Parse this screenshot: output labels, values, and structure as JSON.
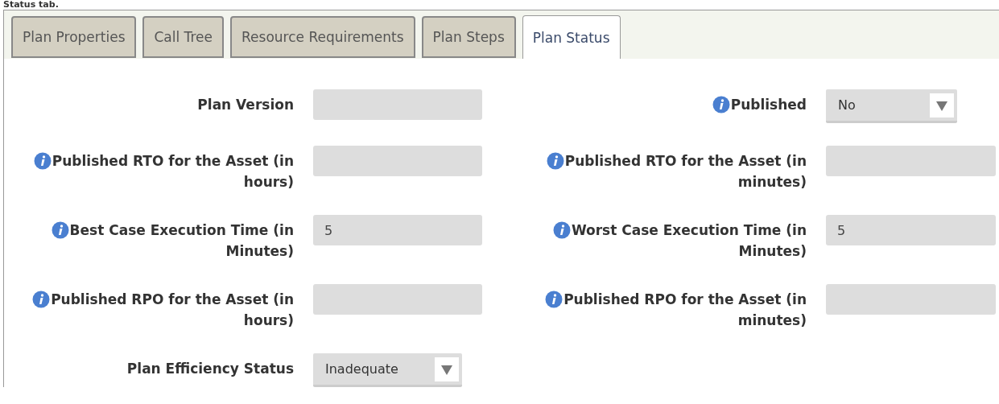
{
  "heading": "Status tab.",
  "tabs": [
    {
      "label": "Plan Properties",
      "selected": false
    },
    {
      "label": "Call Tree",
      "selected": false
    },
    {
      "label": "Resource Requirements",
      "selected": false
    },
    {
      "label": "Plan Steps",
      "selected": false
    },
    {
      "label": "Plan Status",
      "selected": true
    }
  ],
  "rows": [
    {
      "left": {
        "label": "Plan Version",
        "info": false,
        "kind": "text"
      },
      "right": {
        "label": "Published",
        "info": true,
        "kind": "select",
        "value": "No"
      }
    },
    {
      "left": {
        "label": "Published RTO for the Asset (in hours)",
        "info": true,
        "kind": "text"
      },
      "right": {
        "label": "Published RTO for the Asset (in minutes)",
        "info": true,
        "kind": "text"
      }
    },
    {
      "left": {
        "label": "Best Case Execution Time (in Minutes)",
        "info": true,
        "kind": "text",
        "value": "5"
      },
      "right": {
        "label": "Worst Case Execution Time (in Minutes)",
        "info": true,
        "kind": "text",
        "value": "5"
      }
    },
    {
      "left": {
        "label": "Published RPO for the Asset (in hours)",
        "info": true,
        "kind": "text"
      },
      "right": {
        "label": "Published RPO for the Asset (in minutes)",
        "info": true,
        "kind": "text"
      }
    },
    {
      "left": {
        "label": "Plan Efficiency Status",
        "info": false,
        "kind": "select",
        "value": "Inadequate"
      }
    }
  ]
}
